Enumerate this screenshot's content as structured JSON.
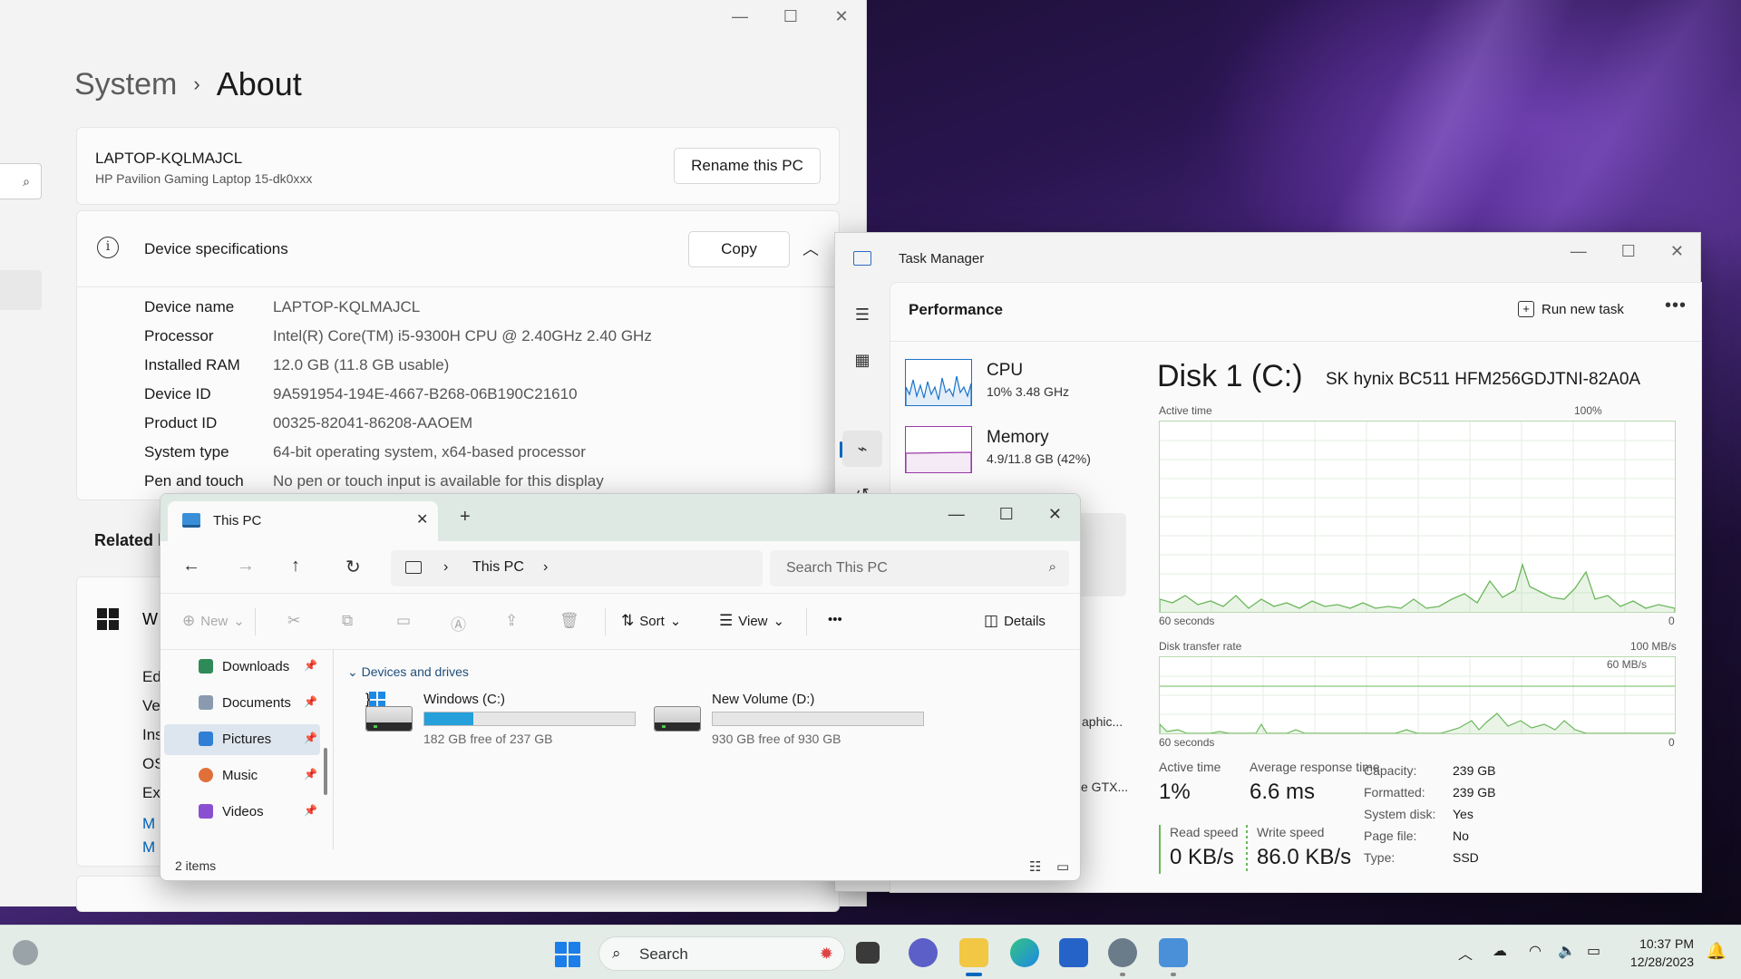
{
  "settings": {
    "window_controls": [
      "—",
      "☐",
      "✕"
    ],
    "breadcrumb_parent": "System",
    "breadcrumb_sep": "›",
    "breadcrumb_current": "About",
    "pc_name": "LAPTOP-KQLMAJCL",
    "pc_model": "HP Pavilion Gaming Laptop 15-dk0xxx",
    "rename_button": "Rename this PC",
    "device_specs_title": "Device specifications",
    "copy_button": "Copy",
    "specs": [
      {
        "label": "Device name",
        "value": "LAPTOP-KQLMAJCL"
      },
      {
        "label": "Processor",
        "value": "Intel(R) Core(TM) i5-9300H CPU @ 2.40GHz   2.40 GHz"
      },
      {
        "label": "Installed RAM",
        "value": "12.0 GB (11.8 GB usable)"
      },
      {
        "label": "Device ID",
        "value": "9A591954-194E-4667-B268-06B190C21610"
      },
      {
        "label": "Product ID",
        "value": "00325-82041-86208-AAOEM"
      },
      {
        "label": "System type",
        "value": "64-bit operating system, x64-based processor"
      },
      {
        "label": "Pen and touch",
        "value": "No pen or touch input is available for this display"
      }
    ],
    "related_label": "Related l",
    "windows_card_label": "W",
    "windows_rows": [
      "Ed",
      "Ve",
      "Ins",
      "OS",
      "Ex"
    ],
    "windows_links": [
      "M",
      "M"
    ]
  },
  "task_manager": {
    "title": "Task Manager",
    "window_controls": [
      "—",
      "☐",
      "✕"
    ],
    "section": "Performance",
    "run_new_task": "Run new task",
    "more": "•••",
    "resources": [
      {
        "name": "CPU",
        "value": "10%  3.48 GHz",
        "color": "#1a73c8"
      },
      {
        "name": "Memory",
        "value": "4.9/11.8 GB (42%)",
        "color": "#9a3aa8"
      }
    ],
    "truncated_items": [
      "aphic...",
      "e GTX..."
    ],
    "disk_title": "Disk 1 (C:)",
    "disk_model": "SK hynix BC511 HFM256GDJTNI-82A0A",
    "active_time_graph": {
      "label": "Active time",
      "max": "100%",
      "time_label": "60 seconds",
      "min": "0"
    },
    "transfer_graph": {
      "label": "Disk transfer rate",
      "max": "100 MB/s",
      "mid": "60 MB/s",
      "time_label": "60 seconds",
      "min": "0"
    },
    "stats": {
      "active_time_label": "Active time",
      "active_time_value": "1%",
      "response_label": "Average response time",
      "response_value": "6.6 ms",
      "read_label": "Read speed",
      "read_value": "0 KB/s",
      "write_label": "Write speed",
      "write_value": "86.0 KB/s"
    },
    "properties": [
      {
        "label": "Capacity:",
        "value": "239 GB"
      },
      {
        "label": "Formatted:",
        "value": "239 GB"
      },
      {
        "label": "System disk:",
        "value": "Yes"
      },
      {
        "label": "Page file:",
        "value": "No"
      },
      {
        "label": "Type:",
        "value": "SSD"
      }
    ],
    "accent_color": "#6cb85c"
  },
  "explorer": {
    "tab_title": "This PC",
    "tab_close": "✕",
    "new_tab": "+",
    "window_controls": [
      "—",
      "☐",
      "✕"
    ],
    "nav": {
      "back": "←",
      "forward": "→",
      "up": "↑",
      "refresh": "↻"
    },
    "address": [
      "›",
      "This PC",
      "›"
    ],
    "search_placeholder": "Search This PC",
    "toolbar": {
      "new": "New",
      "sort": "Sort",
      "view": "View",
      "more": "•••",
      "details": "Details"
    },
    "quick_access": [
      {
        "label": "Downloads",
        "color": "#2e8b57"
      },
      {
        "label": "Documents",
        "color": "#8a9bb0"
      },
      {
        "label": "Pictures",
        "color": "#2f7fd6"
      },
      {
        "label": "Music",
        "color": "#e0703a"
      },
      {
        "label": "Videos",
        "color": "#8a4fd1"
      }
    ],
    "group_title": "Devices and drives",
    "drives": [
      {
        "name": "Windows (C:)",
        "free": "182 GB free of 237 GB",
        "used_fraction": 0.232
      },
      {
        "name": "New Volume (D:)",
        "free": "930 GB free of 930 GB",
        "used_fraction": 0.0
      }
    ],
    "status": "2 items"
  },
  "taskbar": {
    "search_label": "Search",
    "time": "10:37 PM",
    "date": "12/28/2023"
  }
}
